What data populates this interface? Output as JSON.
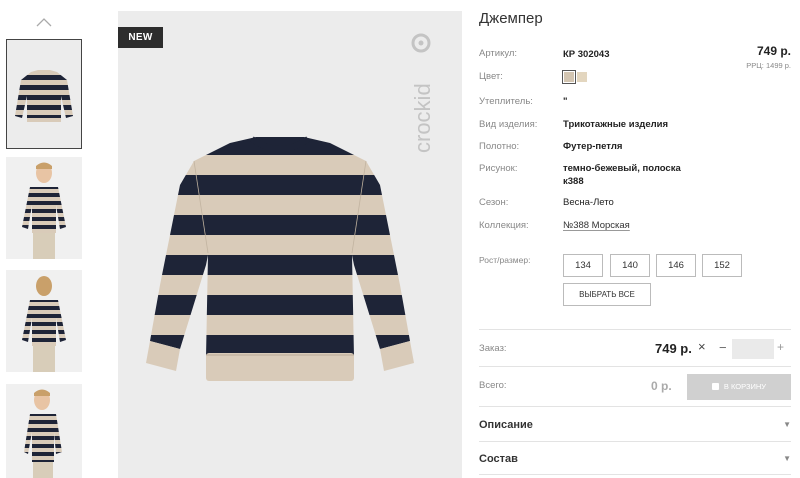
{
  "product": {
    "title": "Джемпер",
    "badge": "NEW",
    "brand_logo": "crockid",
    "price": "749 р.",
    "rrc_price": "РРЦ: 1499 р."
  },
  "specs": {
    "article_label": "Артикул:",
    "article_value": "КР 302043",
    "color_label": "Цвет:",
    "colors": [
      "#d3c5b1",
      "#e3d6bf"
    ],
    "insulation_label": "Утеплитель:",
    "insulation_value": "\"",
    "type_label": "Вид изделия:",
    "type_value": "Трикотажные изделия",
    "fabric_label": "Полотно:",
    "fabric_value": "Футер-петля",
    "pattern_label": "Рисунок:",
    "pattern_value": "темно-бежевый, полоска к388",
    "season_label": "Сезон:",
    "season_value": "Весна-Лето",
    "collection_label": "Коллекция:",
    "collection_value": "№388 Морская"
  },
  "sizes": {
    "label": "Рост/размер:",
    "options": [
      "134",
      "140",
      "146",
      "152"
    ],
    "select_all": "ВЫБРАТЬ ВСЕ"
  },
  "order": {
    "label": "Заказ:",
    "price": "749 р.",
    "times": "×",
    "minus": "−",
    "plus": "+",
    "quantity": ""
  },
  "total": {
    "label": "Всего:",
    "value": "0 р.",
    "cart_button": "В КОРЗИНУ"
  },
  "accordions": [
    "Описание",
    "Состав"
  ],
  "colors": {
    "stripe_dark": "#1e2437",
    "stripe_light": "#d9cbb9",
    "image_bg": "#ececec",
    "cart_disabled": "#d0d0d0"
  },
  "icons": {
    "thumb_up": "chevron-up-icon",
    "accordion": "triangle-down-icon",
    "cart": "cart-icon"
  }
}
